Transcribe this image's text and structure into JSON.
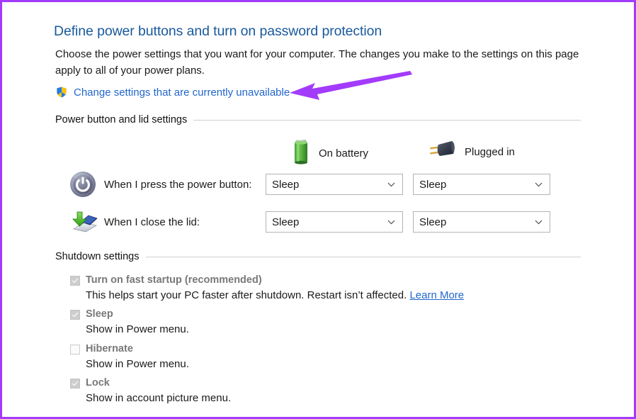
{
  "window": {
    "accent_border_color": "#a33bfb"
  },
  "header": {
    "title": "Define power buttons and turn on password protection",
    "description": "Choose the power settings that you want for your computer. The changes you make to the settings on this page apply to all of your power plans.",
    "uac_link": {
      "icon": "shield-icon",
      "label": "Change settings that are currently unavailable",
      "color": "#2266cc"
    },
    "annotation": {
      "type": "arrow",
      "direction": "left",
      "color": "#a33bfb"
    }
  },
  "sections": {
    "power_lid": {
      "heading": "Power button and lid settings",
      "columns": [
        {
          "icon": "battery-icon",
          "label": "On battery"
        },
        {
          "icon": "power-plug-icon",
          "label": "Plugged in"
        }
      ],
      "rows": [
        {
          "icon": "power-button-icon",
          "label": "When I press the power button:",
          "on_battery": "Sleep",
          "plugged_in": "Sleep"
        },
        {
          "icon": "laptop-lid-icon",
          "label": "When I close the lid:",
          "on_battery": "Sleep",
          "plugged_in": "Sleep"
        }
      ]
    },
    "shutdown": {
      "heading": "Shutdown settings",
      "items": [
        {
          "label": "Turn on fast startup (recommended)",
          "checked": true,
          "description": "This helps start your PC faster after shutdown. Restart isn’t affected.",
          "link": "Learn More"
        },
        {
          "label": "Sleep",
          "checked": true,
          "description": "Show in Power menu.",
          "link": ""
        },
        {
          "label": "Hibernate",
          "checked": false,
          "description": "Show in Power menu.",
          "link": ""
        },
        {
          "label": "Lock",
          "checked": true,
          "description": "Show in account picture menu.",
          "link": ""
        }
      ]
    }
  }
}
